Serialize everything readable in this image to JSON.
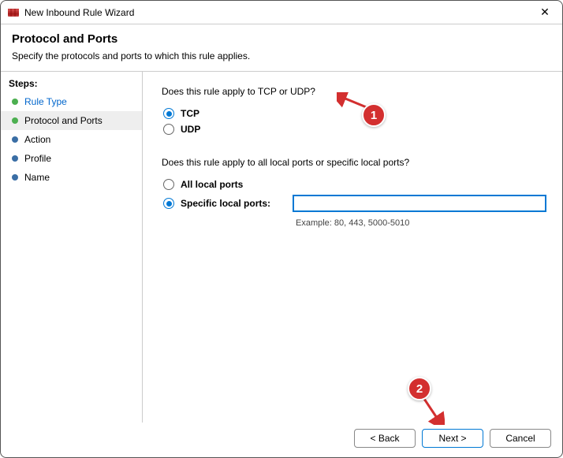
{
  "titlebar": {
    "title": "New Inbound Rule Wizard"
  },
  "header": {
    "heading": "Protocol and Ports",
    "subheading": "Specify the protocols and ports to which this rule applies."
  },
  "sidebar": {
    "heading": "Steps:",
    "items": [
      {
        "label": "Rule Type",
        "state": "completed",
        "bullet": "green"
      },
      {
        "label": "Protocol and Ports",
        "state": "current",
        "bullet": "green"
      },
      {
        "label": "Action",
        "state": "pending",
        "bullet": "blue"
      },
      {
        "label": "Profile",
        "state": "pending",
        "bullet": "blue"
      },
      {
        "label": "Name",
        "state": "pending",
        "bullet": "blue"
      }
    ]
  },
  "main": {
    "q1": "Does this rule apply to TCP or UDP?",
    "protocol": {
      "options": [
        {
          "label": "TCP",
          "selected": true
        },
        {
          "label": "UDP",
          "selected": false
        }
      ]
    },
    "q2": "Does this rule apply to all local ports or specific local ports?",
    "ports": {
      "all_label": "All local ports",
      "specific_label": "Specific local ports:",
      "selected": "specific",
      "value": "",
      "example": "Example: 80, 443, 5000-5010"
    }
  },
  "footer": {
    "back": "< Back",
    "next": "Next >",
    "cancel": "Cancel"
  },
  "annotations": {
    "badge1": "1",
    "badge2": "2"
  }
}
